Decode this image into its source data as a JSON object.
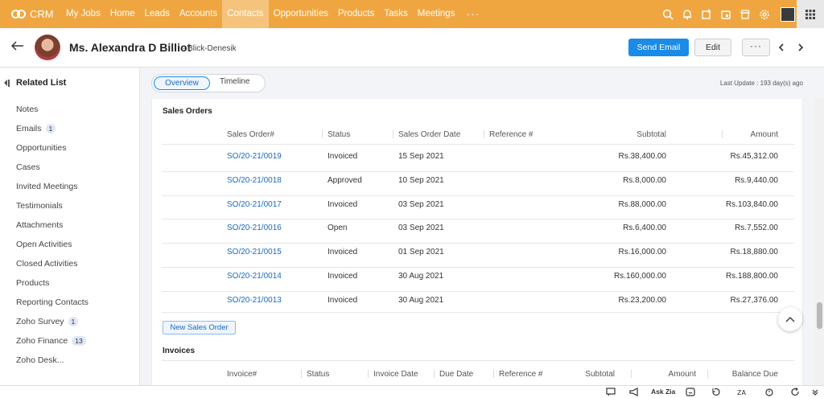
{
  "app": {
    "logo_text": "CRM"
  },
  "nav": {
    "items": [
      "My Jobs",
      "Home",
      "Leads",
      "Accounts",
      "Contacts",
      "Opportunities",
      "Products",
      "Tasks",
      "Meetings"
    ],
    "active": "Contacts",
    "more_label": "···",
    "icons": [
      "search-icon",
      "bell-icon",
      "add-entity-icon",
      "calendar-icon",
      "marketplace-icon",
      "settings-icon",
      "user-avatar",
      "apps-grid-icon"
    ]
  },
  "record": {
    "name": "Ms. Alexandra D Billiot",
    "account": "- Blick-Denesik",
    "send_email_label": "Send Email",
    "edit_label": "Edit",
    "more_label": "···"
  },
  "sidebar": {
    "title": "Related List",
    "items": [
      {
        "label": "Notes",
        "badge": ""
      },
      {
        "label": "Emails",
        "badge": "1"
      },
      {
        "label": "Opportunities",
        "badge": ""
      },
      {
        "label": "Cases",
        "badge": ""
      },
      {
        "label": "Invited Meetings",
        "badge": ""
      },
      {
        "label": "Testimonials",
        "badge": ""
      },
      {
        "label": "Attachments",
        "badge": ""
      },
      {
        "label": "Open Activities",
        "badge": ""
      },
      {
        "label": "Closed Activities",
        "badge": ""
      },
      {
        "label": "Products",
        "badge": ""
      },
      {
        "label": "Reporting Contacts",
        "badge": ""
      },
      {
        "label": "Zoho Survey",
        "badge": "1"
      },
      {
        "label": "Zoho Finance",
        "badge": "13"
      },
      {
        "label": "Zoho Desk...",
        "badge": ""
      }
    ]
  },
  "tabs": {
    "overview": "Overview",
    "timeline": "Timeline",
    "last_update": "Last Update : 193 day(s) ago"
  },
  "sales_orders": {
    "title": "Sales Orders",
    "columns": [
      "Sales Order#",
      "Status",
      "Sales Order Date",
      "Reference #",
      "Subtotal",
      "Amount"
    ],
    "rows": [
      [
        "SO/20-21/0019",
        "Invoiced",
        "15 Sep 2021",
        "",
        "Rs.38,400.00",
        "Rs.45,312.00"
      ],
      [
        "SO/20-21/0018",
        "Approved",
        "10 Sep 2021",
        "",
        "Rs.8,000.00",
        "Rs.9,440.00"
      ],
      [
        "SO/20-21/0017",
        "Invoiced",
        "03 Sep 2021",
        "",
        "Rs.88,000.00",
        "Rs.103,840.00"
      ],
      [
        "SO/20-21/0016",
        "Open",
        "03 Sep 2021",
        "",
        "Rs.6,400.00",
        "Rs.7,552.00"
      ],
      [
        "SO/20-21/0015",
        "Invoiced",
        "01 Sep 2021",
        "",
        "Rs.16,000.00",
        "Rs.18,880.00"
      ],
      [
        "SO/20-21/0014",
        "Invoiced",
        "30 Aug 2021",
        "",
        "Rs.160,000.00",
        "Rs.188,800.00"
      ],
      [
        "SO/20-21/0013",
        "Invoiced",
        "30 Aug 2021",
        "",
        "Rs.23,200.00",
        "Rs.27,376.00"
      ]
    ],
    "new_button": "New Sales Order"
  },
  "invoices": {
    "title": "Invoices",
    "columns": [
      "Invoice#",
      "Status",
      "Invoice Date",
      "Due Date",
      "Reference #",
      "Subtotal",
      "Amount",
      "Balance Due"
    ]
  },
  "bottom_bar": {
    "ask_zia": "Ask Zia"
  },
  "colors": {
    "nav_bg": "#f0a640",
    "nav_active": "#f6c37d",
    "primary": "#1a8ce8",
    "link": "#1a6ac0"
  }
}
